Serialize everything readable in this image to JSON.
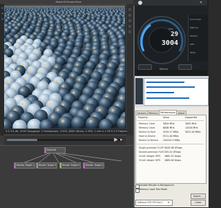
{
  "render_app": {
    "title": "Redshift RenderView",
    "status_line": "3.5 3.4.46, 2016 Траудица: 3 Trubtopoom, 3 005, 4800 3Анка, 3 GPU, 1 лан 4 2 ТИ 0 0 0 Перекл",
    "play_label": "▶",
    "play_label_b": "▸"
  },
  "node_editor": {
    "nodes": [
      {
        "label": "Redshift",
        "color": "#c45cc8"
      },
      {
        "label": "Render Target 1",
        "color": "#c45cc8"
      },
      {
        "label": "Render Target 3",
        "color": "#6aa0d8"
      },
      {
        "label": "Render Target 5",
        "color": "#8bbf5c"
      },
      {
        "label": "Render Target 4",
        "color": "#c45cc8"
      }
    ]
  },
  "gpu_widget": {
    "gpu_clock": "29",
    "mem_clock": "3004",
    "clock_unit": "MHz",
    "side_labels": [
      "Core Clock",
      "Memory",
      "Startup",
      "GPU",
      "Temp"
    ],
    "startup_label": "Startup",
    "accent_color": "#4aa8ff"
  },
  "properties": {
    "tabs": [
      "Sensors",
      "Memory",
      "Performance",
      "About"
    ],
    "active_tab": "Performance",
    "columns": [
      "Property",
      "Value",
      "Supported"
    ],
    "rows": [
      {
        "name": "Memory Clock",
        "value": "3004 MHz",
        "extra": "3004 MHz"
      },
      {
        "name": "Memory Clock",
        "value": "6008 MHz",
        "extra": "12016 MHz"
      },
      {
        "name": "Device to Host",
        "value": "4234.17 MB/s",
        "extra": "5021.00 MB/s"
      },
      {
        "name": "Host to Device",
        "value": "5211.00 MB/s",
        "extra": ""
      },
      {
        "name": "Device to Device",
        "value": "244154.3 MB/s",
        "extra": ""
      }
    ],
    "rows2": [
      {
        "name": "Single-precision FLOPS",
        "value": "5045.96 GFlops"
      },
      {
        "name": "Double-precision FLOPS",
        "value": "205.42 GFlops"
      },
      {
        "name": "24-bit Integer IOPS",
        "value": "1682.52 GIops"
      },
      {
        "name": "32-bit Integer IOPS",
        "value": "1685.00 GIops"
      }
    ],
    "update_label": "Update Results in Background",
    "lock_label": "Memory Load Test Mode",
    "export_label": "Export ...",
    "gpu_select": "GeForce GTX 970 Ext 1",
    "close_label": "Close"
  }
}
